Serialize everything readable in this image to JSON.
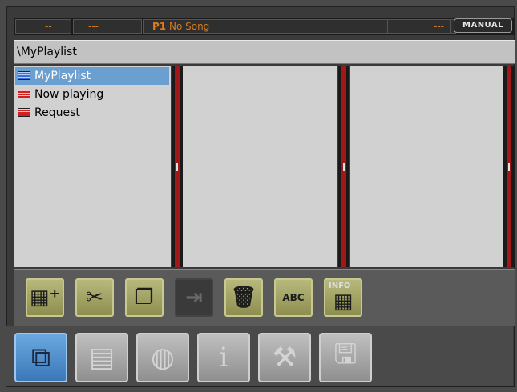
{
  "status_bar": {
    "left_value_a": "--",
    "left_value_b": "---",
    "profile": "P1",
    "song": "No Song",
    "right_value": "---",
    "manual_button": "MANUAL"
  },
  "path_bar": {
    "path": "\\MyPlaylist"
  },
  "playlist_pane": {
    "items": [
      {
        "label": "MyPlaylist",
        "icon": "playlist-blue-icon",
        "selected": true
      },
      {
        "label": "Now playing",
        "icon": "playlist-red-icon",
        "selected": false
      },
      {
        "label": "Request",
        "icon": "playlist-red-icon",
        "selected": false
      }
    ]
  },
  "action_toolbar": {
    "buttons": [
      {
        "name": "new-folder-icon",
        "glyph": "▦⁺"
      },
      {
        "name": "cut-icon",
        "glyph": "✂"
      },
      {
        "name": "copy-icon",
        "glyph": "❐"
      },
      {
        "name": "paste-icon",
        "glyph": "⇥"
      },
      {
        "name": "delete-icon",
        "glyph": "🗑"
      },
      {
        "name": "rename-icon",
        "glyph": "ABC"
      },
      {
        "name": "info-icon",
        "glyph": "▦",
        "label": "INFO"
      }
    ]
  },
  "tab_bar": {
    "tabs": [
      {
        "name": "browser-tab-icon",
        "glyph": "⧉",
        "active": true
      },
      {
        "name": "playlist-tab-icon",
        "glyph": "▤",
        "active": false
      },
      {
        "name": "globe-tab-icon",
        "glyph": "◍",
        "active": false
      },
      {
        "name": "info-tab-icon",
        "glyph": "i",
        "active": false
      },
      {
        "name": "tools-tab-icon",
        "glyph": "⚒",
        "active": false
      },
      {
        "name": "save-tab-icon",
        "glyph": "🖫",
        "active": false
      }
    ]
  },
  "colors": {
    "accent_orange": "#d47a1e",
    "selection_blue": "#6a9fd0",
    "scrollbar_red": "#a01818",
    "button_olive": "#a3a466"
  }
}
